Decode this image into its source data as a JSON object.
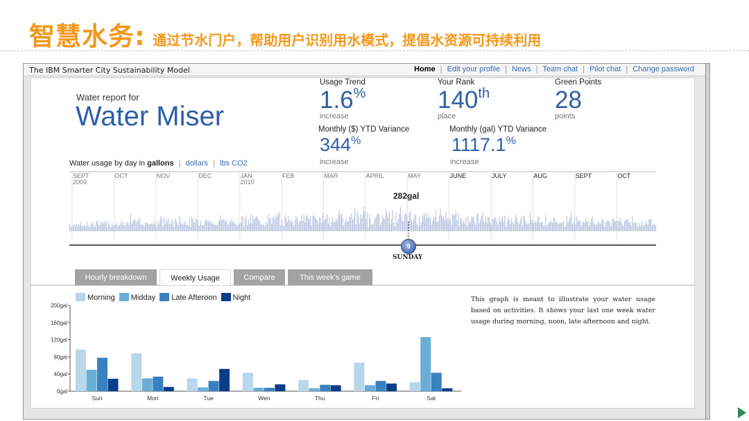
{
  "slide": {
    "title_main": "智慧水务:",
    "title_sub": "通过节水门户，帮助用户识别用水模式，提倡水资源可持续利用",
    "title_color": "#F3981B"
  },
  "app": {
    "brand": "The IBM Smarter City Sustainability Model",
    "nav": [
      "Home",
      "Edit your profile",
      "News",
      "Team chat",
      "Pilot chat",
      "Change password"
    ],
    "accent": "#2d5fa8",
    "link_color": "#3a6fb0"
  },
  "report": {
    "for_label": "Water report for",
    "name": "Water Miser"
  },
  "stats": {
    "trend_label": "Usage Trend",
    "trend_value": "1.6",
    "trend_unit": "%",
    "trend_sub": "increase",
    "rank_label": "Your Rank",
    "rank_value": "140",
    "rank_suffix": "th",
    "rank_sub": "place",
    "points_label": "Green Points",
    "points_value": "28",
    "points_sub": "points",
    "dollar_label": "Monthly ($) YTD Variance",
    "dollar_value": "344",
    "dollar_unit": "%",
    "dollar_sub": "increase",
    "gal_label": "Monthly (gal) YTD Variance",
    "gal_value": "1117.1",
    "gal_unit": "%",
    "gal_sub": "increase"
  },
  "usage_toggle": {
    "label": "Water usage by day in",
    "active": "gallons",
    "options": [
      "dollars",
      "lbs CO2"
    ]
  },
  "timeline": {
    "months": [
      {
        "label": "SEPT\n2009",
        "dark": false
      },
      {
        "label": "OCT",
        "dark": false
      },
      {
        "label": "NOV",
        "dark": false
      },
      {
        "label": "DEC",
        "dark": false
      },
      {
        "label": "JAN\n2010",
        "dark": false
      },
      {
        "label": "FEB",
        "dark": false
      },
      {
        "label": "MAR",
        "dark": false
      },
      {
        "label": "APRIL",
        "dark": false
      },
      {
        "label": "MAY",
        "dark": false
      },
      {
        "label": "JUNE",
        "dark": true
      },
      {
        "label": "JULY",
        "dark": true
      },
      {
        "label": "AUG",
        "dark": true
      },
      {
        "label": "SEPT",
        "dark": true
      },
      {
        "label": "OCT",
        "dark": true
      }
    ],
    "selected_value": "282gal",
    "selected_day": "SUNDAY",
    "slider_number": "9",
    "slider_color": "#5a7fb8"
  },
  "tabs": [
    "Hourly breakdown",
    "Weekly Usage",
    "Compare",
    "This week's game"
  ],
  "active_tab": 1,
  "description": "This graph is meant to illustrate your water usage based on activities. It shows your last one week water usage during morning, noon, late afternoon and night.",
  "chart_data": {
    "type": "bar",
    "categories": [
      "Sun",
      "Mon",
      "Tue",
      "Wen",
      "Thu",
      "Fri",
      "Sat"
    ],
    "series": [
      {
        "name": "Morning",
        "color": "#b9d7ea",
        "values": [
          97,
          88,
          30,
          43,
          26,
          67,
          21
        ]
      },
      {
        "name": "Midday",
        "color": "#6aaed6",
        "values": [
          50,
          30,
          9,
          8,
          7,
          14,
          126
        ]
      },
      {
        "name": "Late Afteroon",
        "color": "#3a81c0",
        "values": [
          78,
          34,
          24,
          8,
          15,
          24,
          43
        ]
      },
      {
        "name": "Night",
        "color": "#0a3d8a",
        "values": [
          29,
          10,
          52,
          16,
          14,
          18,
          7
        ]
      }
    ],
    "yticks": [
      "200gal",
      "160gal",
      "120gal",
      "80gal",
      "40gal",
      "0gal"
    ],
    "ylim": [
      0,
      200
    ]
  }
}
